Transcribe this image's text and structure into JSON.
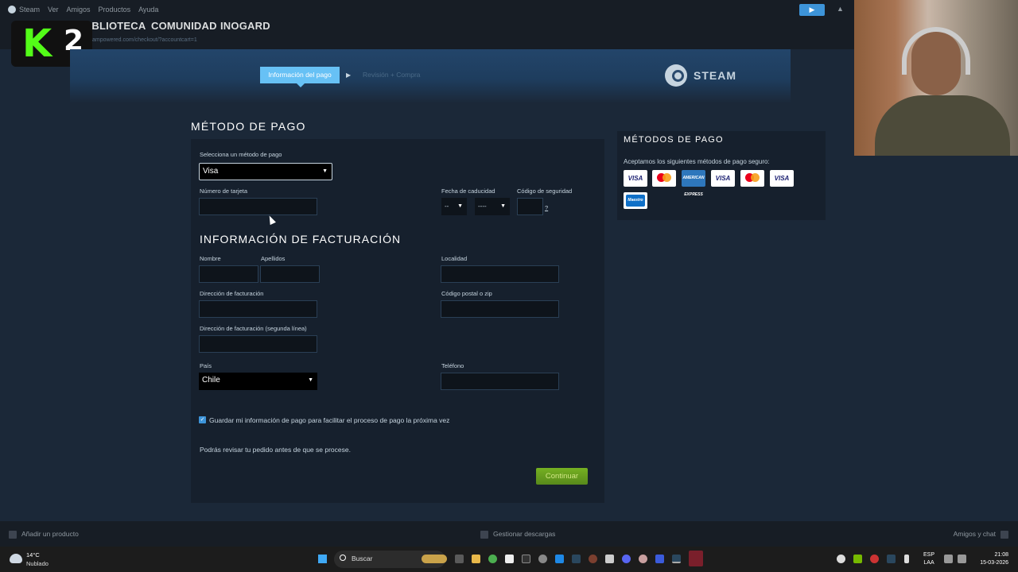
{
  "steam_menu": {
    "app": "Steam",
    "items": [
      "Ver",
      "Amigos",
      "Productos",
      "Ayuda"
    ]
  },
  "nav": {
    "items": [
      "BIBLIOTECA",
      "COMUNIDAD",
      "INOGARD"
    ]
  },
  "url": "ampowered.com/checkout/?accountcart=1",
  "overlay_logo": {
    "letter": "K",
    "number": "2",
    "color": "#53fc18"
  },
  "checkout": {
    "step_active": "Información del pago",
    "step_next": "Revisión + Compra",
    "brand": "STEAM"
  },
  "payment": {
    "section_title": "MÉTODO DE PAGO",
    "method_label": "Selecciona un método de pago",
    "method_value": "Visa",
    "card_number_label": "Número de tarjeta",
    "expiry_label": "Fecha de caducidad",
    "expiry_month": "--",
    "expiry_year": "----",
    "security_label": "Código de seguridad",
    "security_help": "?"
  },
  "billing": {
    "title": "INFORMACIÓN DE FACTURACIÓN",
    "first_name_label": "Nombre",
    "last_name_label": "Apellidos",
    "city_label": "Localidad",
    "address_label": "Dirección de facturación",
    "zip_label": "Código postal o zip",
    "address2_label": "Dirección de facturación (segunda línea)",
    "country_label": "País",
    "country_value": "Chile",
    "phone_label": "Teléfono",
    "save_info": "Guardar mi información de pago para facilitar el proceso de pago la próxima vez",
    "save_checked": true,
    "review_note": "Podrás revisar tu pedido antes de que se procese.",
    "continue": "Continuar"
  },
  "methods_panel": {
    "title": "MÉTODOS DE PAGO",
    "text": "Aceptamos los siguientes métodos de pago seguro:",
    "cards": [
      "VISA",
      "mastercard",
      "AMERICAN EXPRESS",
      "VISA",
      "mastercard",
      "VISA",
      "Maestro"
    ]
  },
  "bottom_bar": {
    "add_product": "Añadir un producto",
    "downloads": "Gestionar descargas",
    "friends": "Amigos y chat"
  },
  "taskbar": {
    "temperature": "14°C",
    "condition": "Nublado",
    "search": "Buscar",
    "lang_top": "ESP",
    "lang_bottom": "LAA",
    "time": "21:08",
    "date": "15-03-2026"
  },
  "colors": {
    "accent": "#67c1f5",
    "continue": "#75b022",
    "background": "#1b2838"
  }
}
